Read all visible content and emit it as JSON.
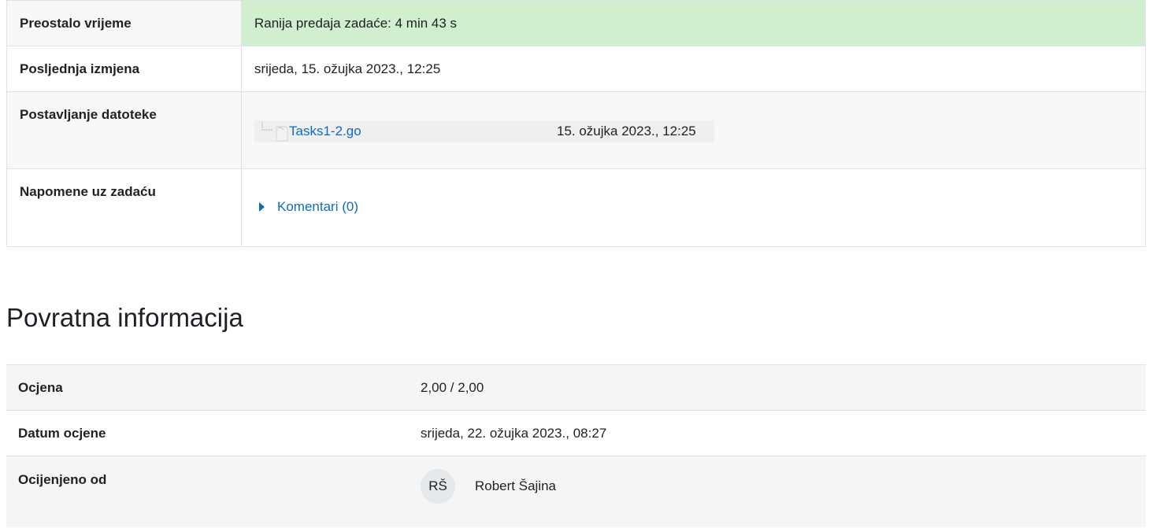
{
  "submission_status": {
    "rows": [
      {
        "label": "Preostalo vrijeme",
        "value": "Ranija predaja zadaće: 4 min 43 s"
      },
      {
        "label": "Posljednja izmjena",
        "value": "srijeda, 15. ožujka 2023., 12:25"
      },
      {
        "label": "Postavljanje datoteke",
        "file_name": "Tasks1-2.go",
        "file_date": "15. ožujka 2023., 12:25"
      },
      {
        "label": "Napomene uz zadaću",
        "comments_label": "Komentari (0)"
      }
    ]
  },
  "feedback": {
    "heading": "Povratna informacija",
    "rows": [
      {
        "label": "Ocjena",
        "value": "2,00 / 2,00"
      },
      {
        "label": "Datum ocjene",
        "value": "srijeda, 22. ožujka 2023., 08:27"
      },
      {
        "label": "Ocijenjeno od",
        "avatar_initials": "RŠ",
        "grader_name": "Robert Šajina"
      }
    ]
  },
  "colors": {
    "success_bg": "#cfefcf",
    "link": "#0f6cbf"
  }
}
